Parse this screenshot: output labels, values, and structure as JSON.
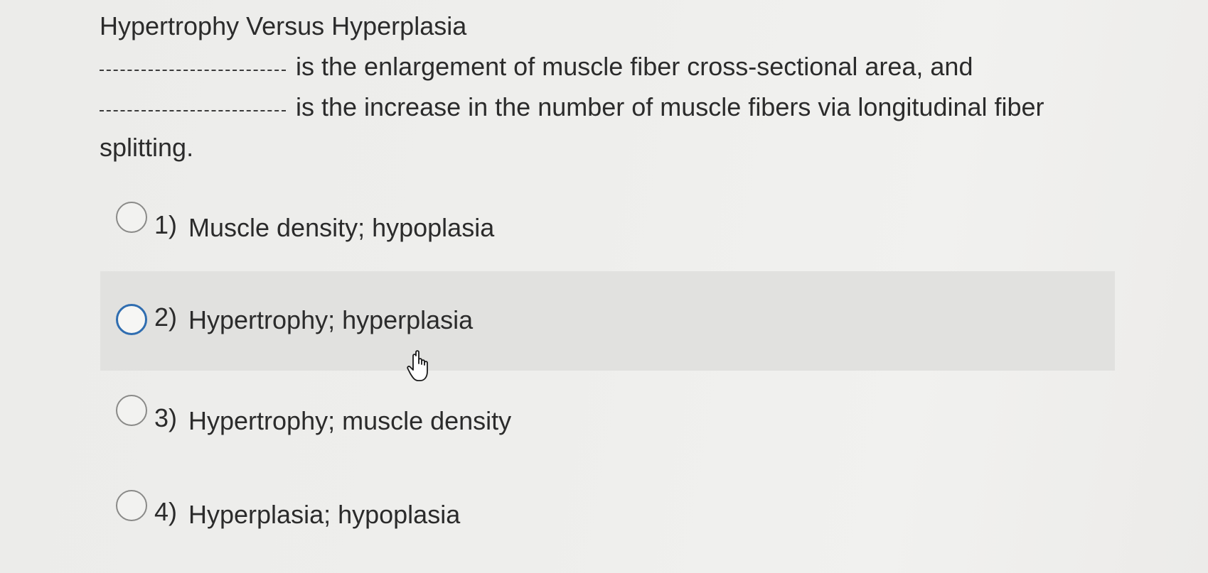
{
  "question": {
    "title": "Hypertrophy Versus Hyperplasia",
    "line1": "is the enlargement of muscle fiber cross-sectional area, and",
    "line2": "is the increase in the number of muscle fibers via longitudinal fiber",
    "line3": "splitting."
  },
  "options": [
    {
      "number": "1)",
      "text": "Muscle density; hypoplasia"
    },
    {
      "number": "2)",
      "text": "Hypertrophy; hyperplasia"
    },
    {
      "number": "3)",
      "text": "Hypertrophy; muscle density"
    },
    {
      "number": "4)",
      "text": "Hyperplasia; hypoplasia"
    }
  ],
  "hovered_option": "2)",
  "colors": {
    "background": "#eeeeec",
    "hover_row": "#e1e1df",
    "radio_hover_border": "#2f6db0",
    "text": "#2b2b2b"
  },
  "cursor_icon": "hand-pointer-icon"
}
